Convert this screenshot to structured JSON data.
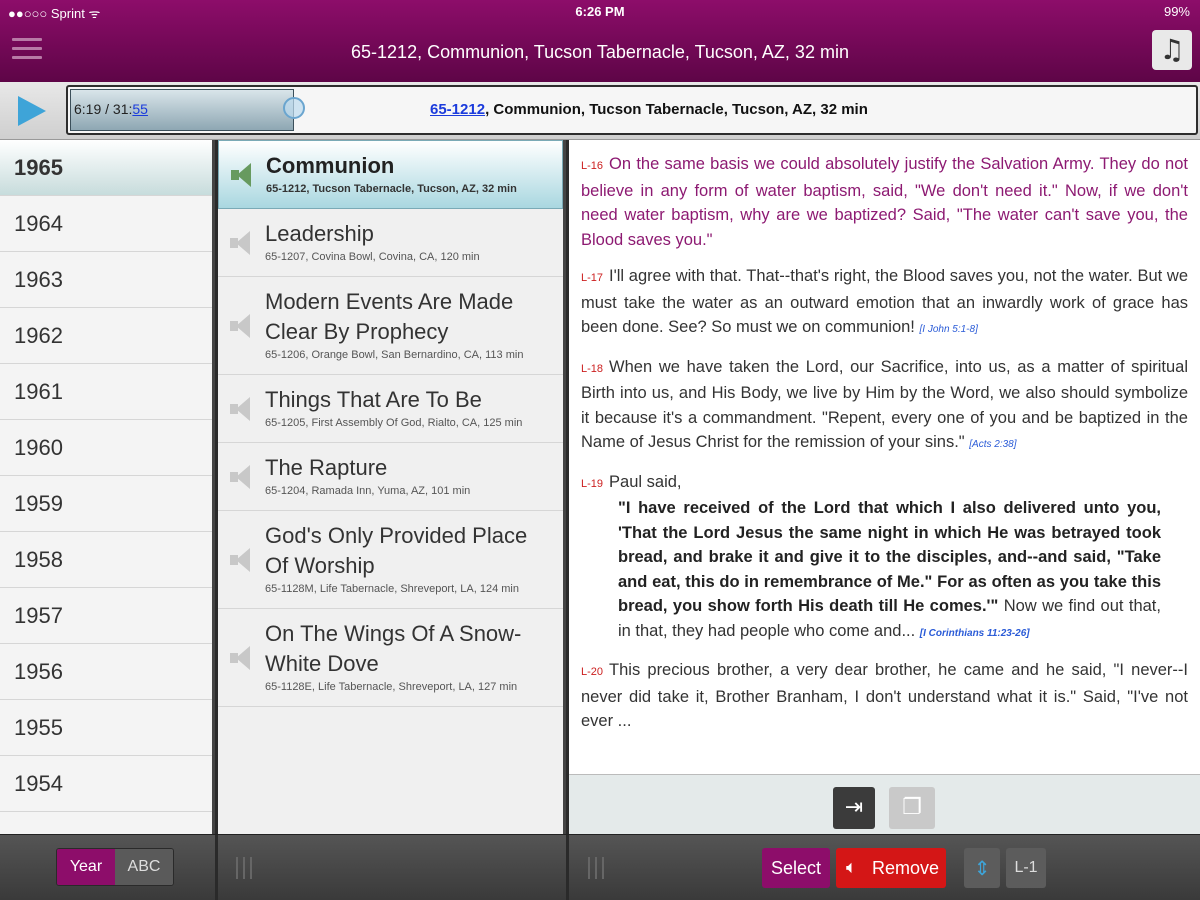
{
  "status": {
    "carrier": "●●○○○ Sprint ᯤ",
    "time": "6:26 PM",
    "battery": "99%"
  },
  "header": {
    "title": "65-1212, Communion, Tucson Tabernacle, Tucson, AZ, 32 min",
    "music_icon": "music-note-icon"
  },
  "player": {
    "time_elapsed": "6:19 / 31:",
    "time_link": "55",
    "progress": 0.2,
    "track_code": "65-1212",
    "track_rest": ", Communion, Tucson Tabernacle, Tucson, AZ, 32 min"
  },
  "years": [
    "1965",
    "1964",
    "1963",
    "1962",
    "1961",
    "1960",
    "1959",
    "1958",
    "1957",
    "1956",
    "1955",
    "1954"
  ],
  "selected_year": "1965",
  "sermons": [
    {
      "title": "Communion",
      "sub": "65-1212, Tucson Tabernacle, Tucson, AZ, 32 min",
      "selected": true
    },
    {
      "title": "Leadership",
      "sub": "65-1207, Covina Bowl, Covina, CA, 120 min"
    },
    {
      "title": "Modern Events Are Made Clear By Prophecy",
      "sub": "65-1206, Orange Bowl, San Bernardino, CA, 113 min"
    },
    {
      "title": "Things That Are To Be",
      "sub": "65-1205, First Assembly Of God, Rialto, CA, 125 min"
    },
    {
      "title": "The Rapture",
      "sub": "65-1204, Ramada Inn, Yuma, AZ, 101 min"
    },
    {
      "title": "God's Only Provided Place Of Worship",
      "sub": "65-1128M, Life Tabernacle, Shreveport, LA, 124 min"
    },
    {
      "title": "On The Wings Of A Snow-White Dove",
      "sub": "65-1128E, Life Tabernacle, Shreveport, LA, 127 min"
    }
  ],
  "reader": {
    "p16": {
      "num": "L-16",
      "text": "On the same basis we could absolutely justify the Salvation Army. They do not believe in any form of water baptism, said, \"We don't need it.\" Now, if we don't need water baptism, why are we baptized? Said, \"The water can't save you, the Blood saves you.\""
    },
    "p17": {
      "num": "L-17",
      "text": "I'll agree with that. That--that's right, the Blood saves you, not the water. But we must take the water as an outward emotion that an inwardly work of grace has been done. See? So must we on communion!",
      "ref": "[I John 5:1-8]"
    },
    "p18": {
      "num": "L-18",
      "text": "When we have taken the Lord, our Sacrifice, into us, as a matter of spiritual Birth into us, and His Body, we live by Him by the Word, we also should symbolize it because it's a commandment. \"Repent, every one of you and be baptized in the Name of Jesus Christ for the remission of your sins.\"",
      "ref": "[Acts 2:38]"
    },
    "p19": {
      "num": "L-19",
      "intro": "Paul said,",
      "quote": "\"I have received of the Lord that which I also delivered unto you, 'That the Lord Jesus the same night in which He was betrayed took bread, and brake it and give it to the disciples, and--and said, \"Take and eat, this do in remembrance of Me.\" For as often as you take this bread, you show forth His death till He comes.'\"",
      "after": "Now we find out that, in that, they had people who come and...",
      "ref": "[I Corinthians 11:23-26]"
    },
    "p20": {
      "num": "L-20",
      "text": "This precious brother, a very dear brother, he came and he said, \"I never--I never did take it, Brother Branham, I don't understand what it is.\" Said, \"I've not ever ..."
    }
  },
  "bottom": {
    "year": "Year",
    "abc": "ABC",
    "select": "Select",
    "remove": "Remove",
    "line": "L-1"
  },
  "colors": {
    "accent": "#8d0d6a",
    "remove": "#d41616",
    "play": "#3ea4d8"
  }
}
